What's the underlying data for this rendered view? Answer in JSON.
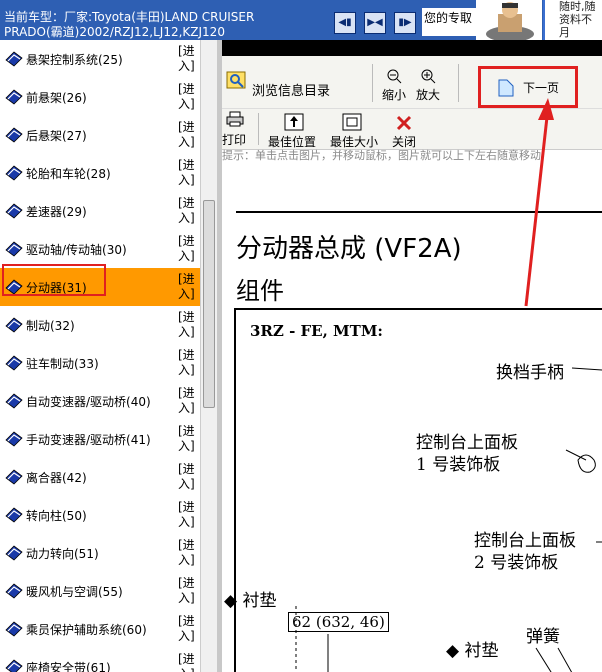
{
  "header": {
    "car_label": "当前车型：",
    "car_value": "厂家:Toyota(丰田)LAND CRUISER PRADO(霸道)2002/RZJ12,LJ12,KZJ120",
    "pro_text": "您的专取",
    "side_message_line1": "随时,随",
    "side_message_line2": "资料不月",
    "nav_buttons": [
      "first-page",
      "fit",
      "last-page"
    ]
  },
  "sidebar": {
    "enter_label": "[进入]",
    "items": [
      {
        "label": "悬架控制系统(25)",
        "icon": "book-icon",
        "active": false
      },
      {
        "label": "前悬架(26)",
        "icon": "book-icon",
        "active": false
      },
      {
        "label": "后悬架(27)",
        "icon": "book-icon",
        "active": false
      },
      {
        "label": "轮胎和车轮(28)",
        "icon": "book-icon",
        "active": false
      },
      {
        "label": "差速器(29)",
        "icon": "book-icon",
        "active": false
      },
      {
        "label": "驱动轴/传动轴(30)",
        "icon": "book-icon",
        "active": false
      },
      {
        "label": "分动器(31)",
        "icon": "book-icon",
        "active": true
      },
      {
        "label": "制动(32)",
        "icon": "book-icon",
        "active": false
      },
      {
        "label": "驻车制动(33)",
        "icon": "book-icon",
        "active": false
      },
      {
        "label": "自动变速器/驱动桥(40)",
        "icon": "book-icon",
        "active": false
      },
      {
        "label": "手动变速器/驱动桥(41)",
        "icon": "book-icon",
        "active": false
      },
      {
        "label": "离合器(42)",
        "icon": "book-icon",
        "active": false
      },
      {
        "label": "转向柱(50)",
        "icon": "book-icon",
        "active": false
      },
      {
        "label": "动力转向(51)",
        "icon": "book-icon",
        "active": false
      },
      {
        "label": "暖风机与空调(55)",
        "icon": "book-icon",
        "active": false
      },
      {
        "label": "乘员保护辅助系统(60)",
        "icon": "book-icon",
        "active": false
      },
      {
        "label": "座椅安全带(61)",
        "icon": "book-icon",
        "active": false
      }
    ]
  },
  "toolbar": {
    "browse_catalog": "浏览信息目录",
    "zoom_out": "缩小",
    "zoom_in": "放大",
    "next_page": "下一页",
    "print": "打印",
    "best_position": "最佳位置",
    "best_size": "最佳大小",
    "close": "关闭"
  },
  "document": {
    "hint": "提示：单击点击图片，并移动鼠标，图片就可以上下左右随意移动",
    "title": "分动器总成 (VF2A)",
    "subtitle": "组件",
    "diagram": {
      "engine_label": "3RZ - FE, MTM:",
      "shift_lever": "换档手柄",
      "console_panel_1_line1": "控制台上面板",
      "console_panel_1_line2": "1 号装饰板",
      "console_panel_2_line1": "控制台上面板",
      "console_panel_2_line2": "2 号装饰板",
      "gasket_left": "◆ 衬垫",
      "gasket_right": "◆ 衬垫",
      "torque_spec": "62 (632, 46)",
      "spring": "弹簧"
    }
  },
  "colors": {
    "banner": "#2e5fb3",
    "active_item": "#ff9900",
    "highlight_border": "#e02020"
  }
}
